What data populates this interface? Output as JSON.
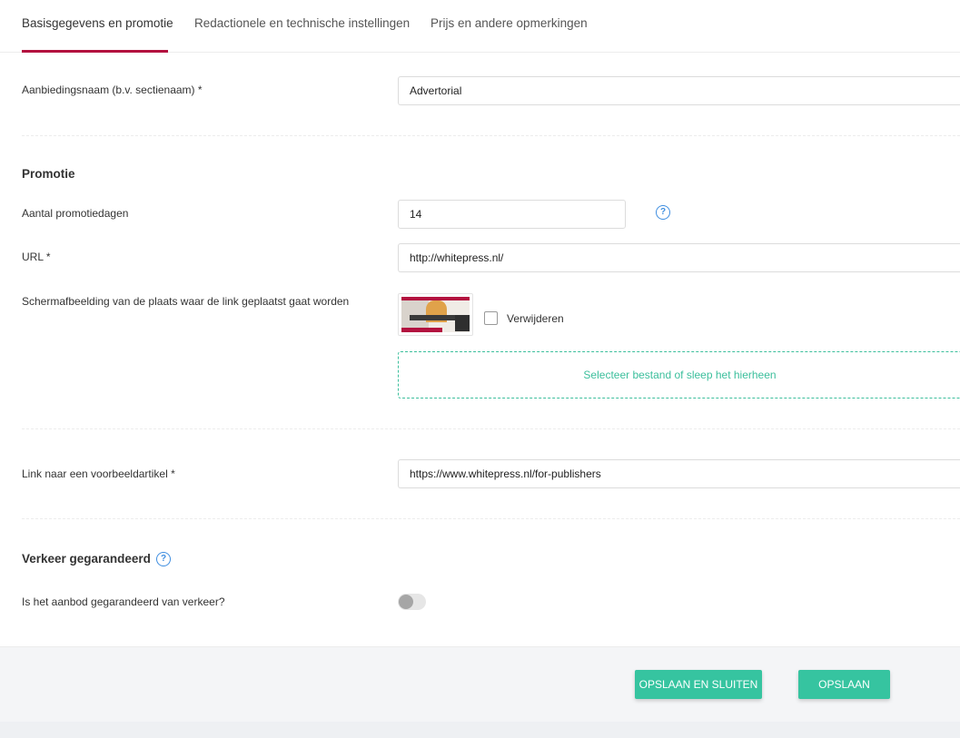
{
  "tabs": [
    {
      "label": "Basisgegevens en promotie",
      "active": true
    },
    {
      "label": "Redactionele en technische instellingen",
      "active": false
    },
    {
      "label": "Prijs en andere opmerkingen",
      "active": false
    }
  ],
  "offer_name": {
    "label": "Aanbiedingsnaam (b.v. sectienaam) *",
    "value": "Advertorial"
  },
  "promotion": {
    "title": "Promotie",
    "days": {
      "label": "Aantal promotiedagen",
      "value": "14"
    },
    "url": {
      "label": "URL *",
      "value": "http://whitepress.nl/"
    },
    "screenshot": {
      "label": "Schermafbeelding van de plaats waar de link geplaatst gaat worden",
      "remove_label": "Verwijderen",
      "remove_checked": false,
      "dropzone_text": "Selecteer bestand of sleep het hierheen"
    }
  },
  "example_article": {
    "label": "Link naar een voorbeeldartikel *",
    "value": "https://www.whitepress.nl/for-publishers"
  },
  "traffic": {
    "title": "Verkeer gegarandeerd",
    "question_label": "Is het aanbod gegarandeerd van verkeer?",
    "enabled": false
  },
  "footer": {
    "save_close_label": "OPSLAAN EN SLUITEN",
    "save_label": "OPSLAAN"
  },
  "icons": {
    "help": "question-circle-icon",
    "help_glyph": "?"
  },
  "colors": {
    "active_tab": "#b3123f",
    "primary_button": "#36c4a0",
    "dropzone": "#3cbf9c",
    "help_icon": "#3f8ee0"
  }
}
